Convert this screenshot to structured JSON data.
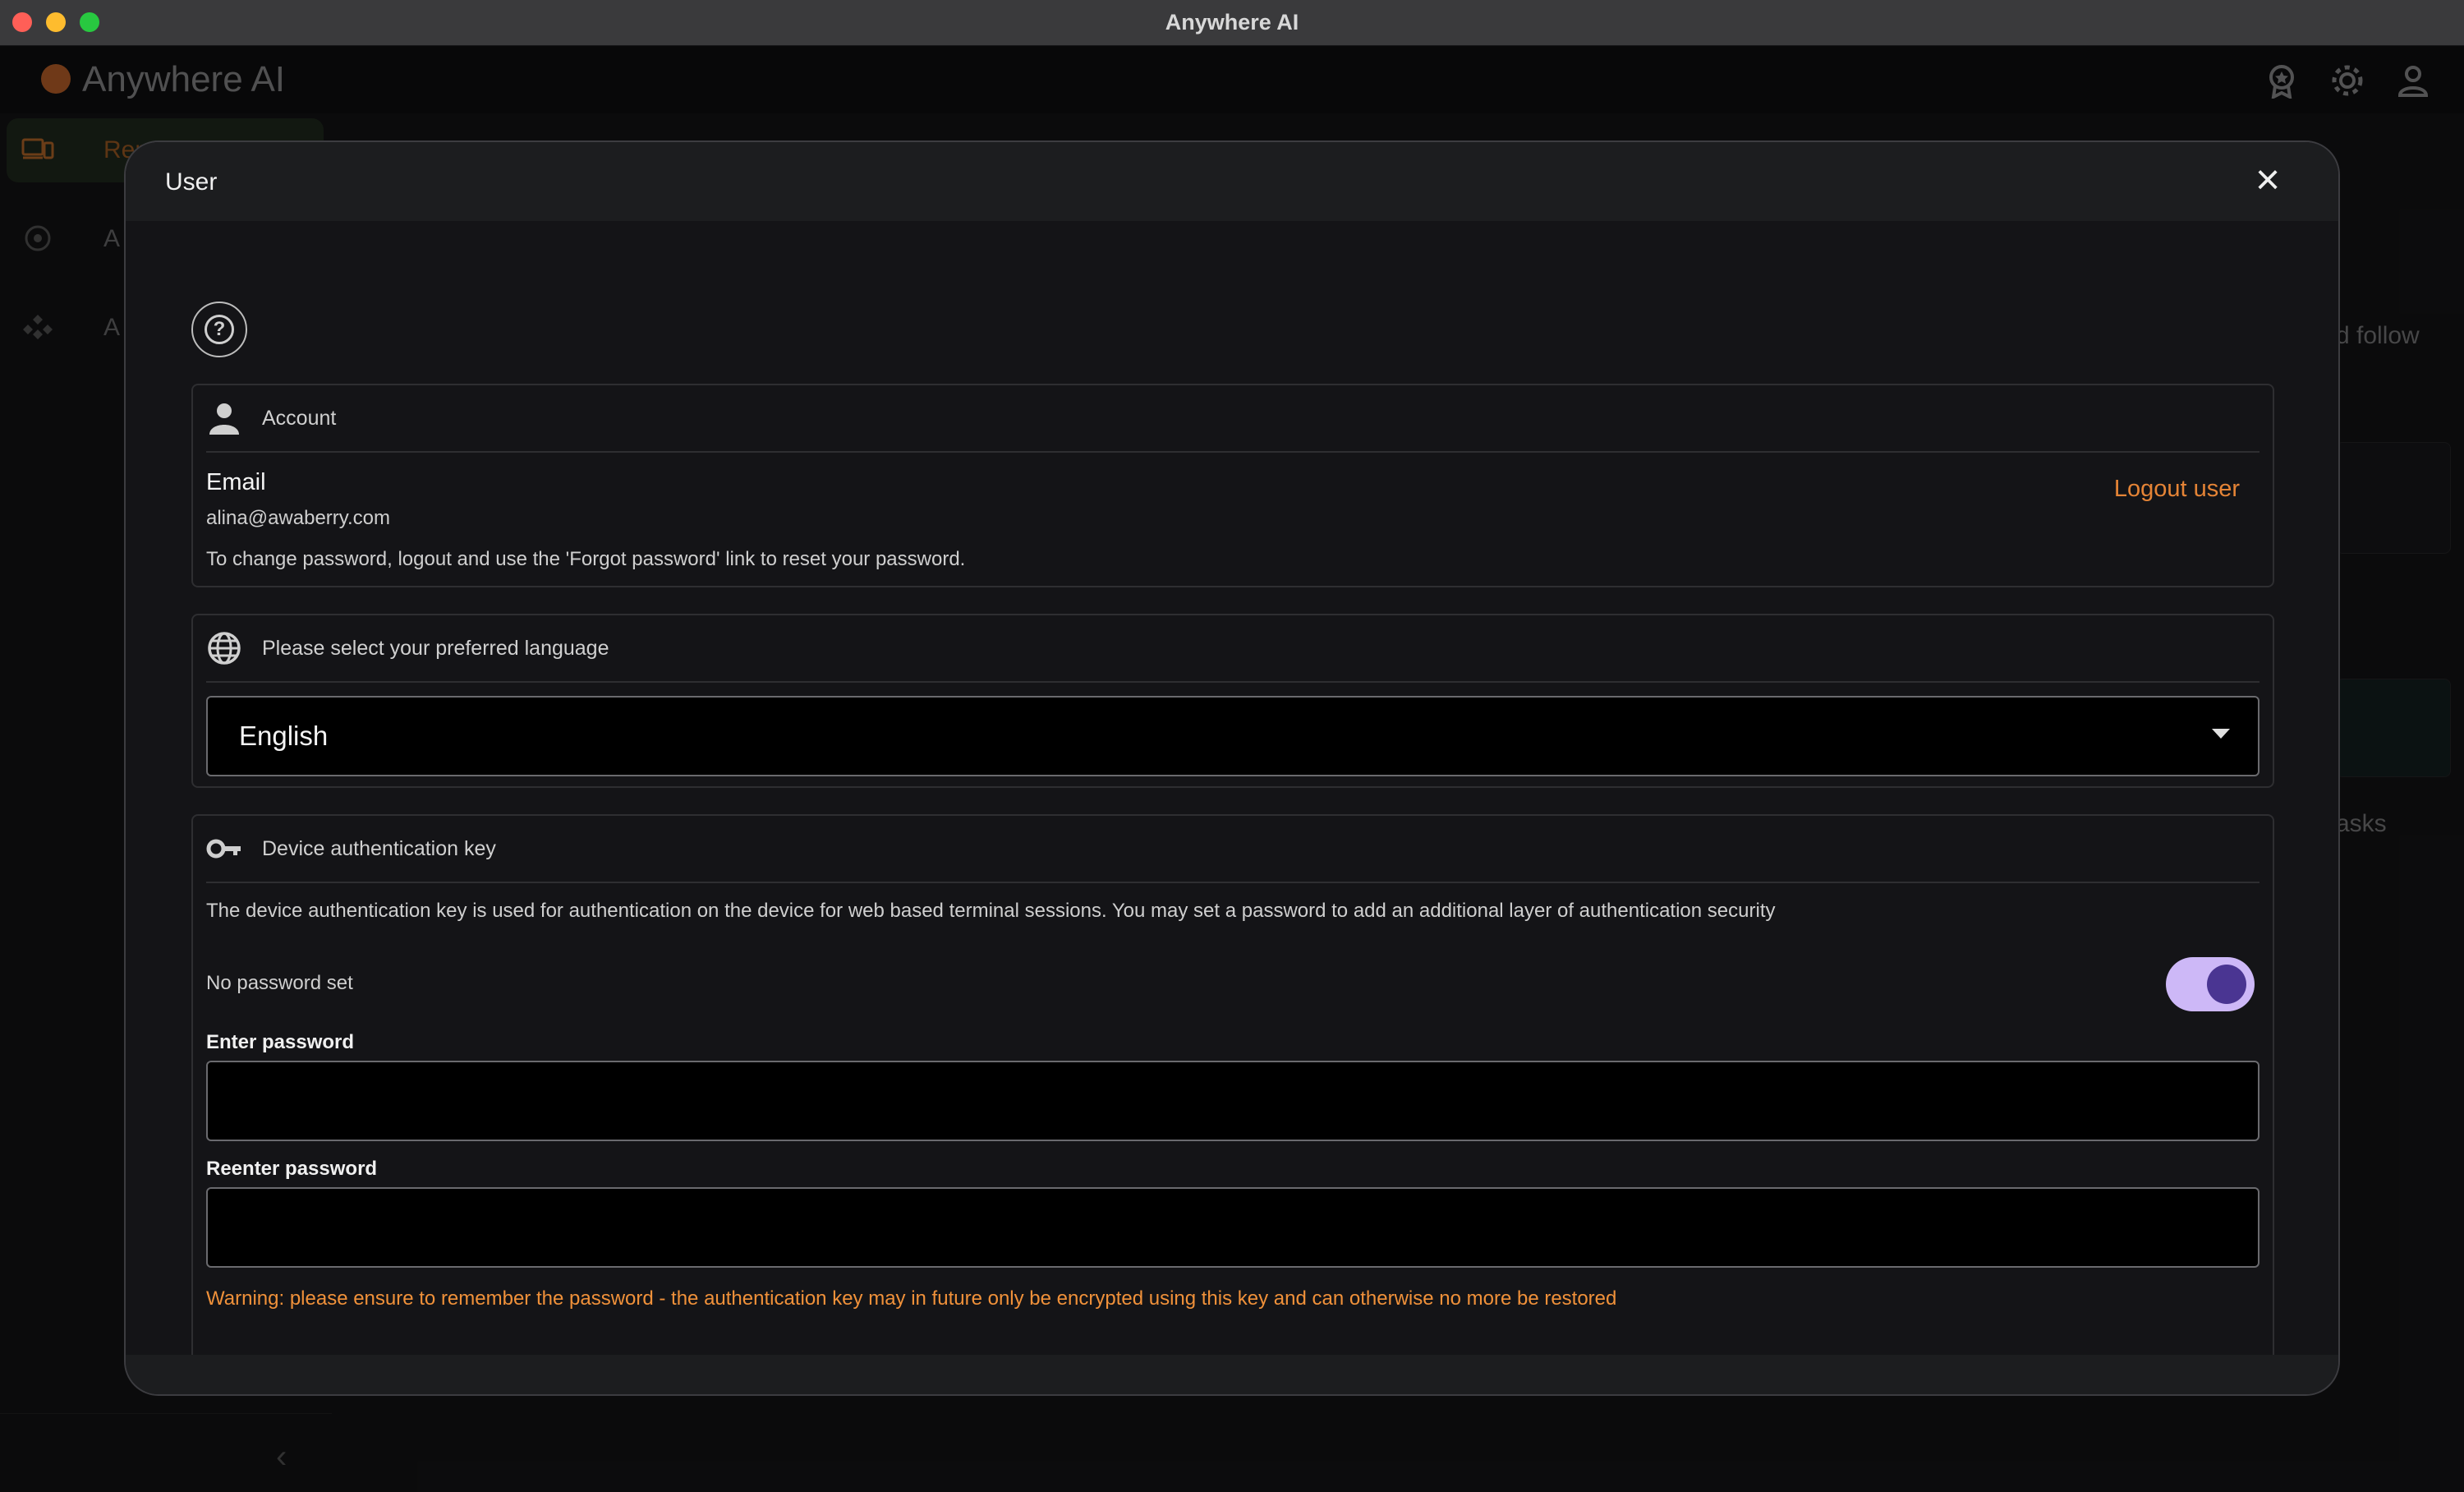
{
  "window": {
    "title": "Anywhere AI"
  },
  "app": {
    "logo_text": "Anywhere AI",
    "sidebar": {
      "items": [
        {
          "label": "Rem",
          "icon": "devices-icon",
          "active": true
        },
        {
          "label": "A",
          "icon": "ai-spark-icon",
          "active": false
        },
        {
          "label": "A",
          "icon": "apps-icon",
          "active": false
        }
      ]
    },
    "background_fragments": {
      "follow": "d follow",
      "tasks": "asks"
    }
  },
  "modal": {
    "title": "User",
    "close_icon": "×",
    "help_icon": "?",
    "account": {
      "title": "Account",
      "email_label": "Email",
      "email_value": "alina@awaberry.com",
      "note": "To change password, logout and use the 'Forgot password' link to reset your password.",
      "logout_label": "Logout user"
    },
    "language": {
      "title": "Please select your preferred language",
      "selected": "English"
    },
    "device_key": {
      "title": "Device authentication key",
      "description": "The device authentication key is used for authentication on the device for web based terminal sessions. You may set a password to add an additional layer of authentication security",
      "password_status": "No password set",
      "toggle_on": true,
      "enter_password_label": "Enter password",
      "reenter_password_label": "Reenter password",
      "warning": "Warning: please ensure to remember the password - the authentication key may in future only be encrypted using this key and can otherwise no more be restored"
    }
  },
  "colors": {
    "accent": "#e58436",
    "toggle_track": "#cdb8f7",
    "toggle_knob": "#4a3592",
    "warning": "#f0913a"
  }
}
